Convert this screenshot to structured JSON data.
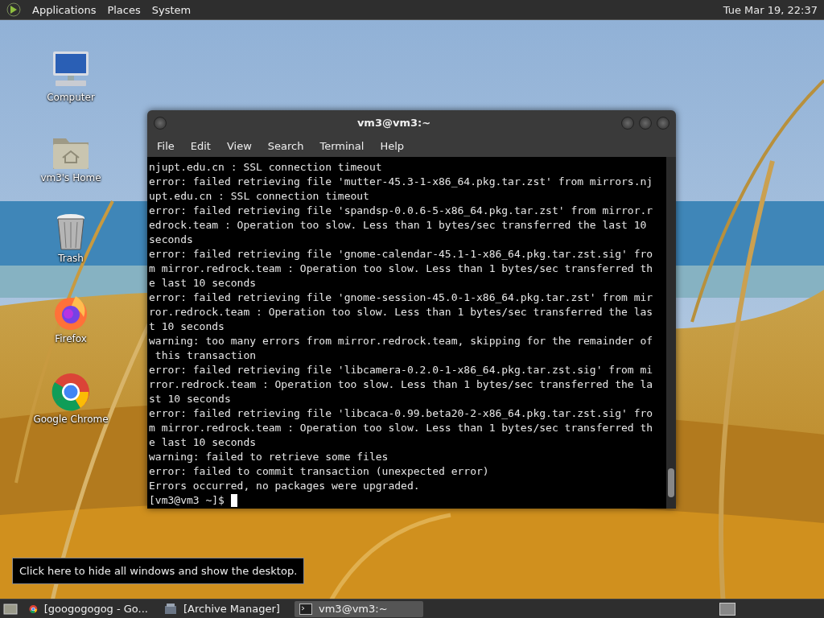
{
  "top_panel": {
    "menus": [
      "Applications",
      "Places",
      "System"
    ],
    "clock": "Tue Mar 19, 22:37"
  },
  "desktop_icons": [
    {
      "label": "Computer",
      "kind": "computer"
    },
    {
      "label": "vm3's Home",
      "kind": "home"
    },
    {
      "label": "Trash",
      "kind": "trash"
    },
    {
      "label": "Firefox",
      "kind": "firefox"
    },
    {
      "label": "Google Chrome",
      "kind": "chrome"
    }
  ],
  "terminal": {
    "title": "vm3@vm3:~",
    "menu": [
      "File",
      "Edit",
      "View",
      "Search",
      "Terminal",
      "Help"
    ],
    "lines": [
      "njupt.edu.cn : SSL connection timeout",
      "error: failed retrieving file 'mutter-45.3-1-x86_64.pkg.tar.zst' from mirrors.nj",
      "upt.edu.cn : SSL connection timeout",
      "error: failed retrieving file 'spandsp-0.0.6-5-x86_64.pkg.tar.zst' from mirror.r",
      "edrock.team : Operation too slow. Less than 1 bytes/sec transferred the last 10",
      "seconds",
      "error: failed retrieving file 'gnome-calendar-45.1-1-x86_64.pkg.tar.zst.sig' fro",
      "m mirror.redrock.team : Operation too slow. Less than 1 bytes/sec transferred th",
      "e last 10 seconds",
      "error: failed retrieving file 'gnome-session-45.0-1-x86_64.pkg.tar.zst' from mir",
      "ror.redrock.team : Operation too slow. Less than 1 bytes/sec transferred the las",
      "t 10 seconds",
      "warning: too many errors from mirror.redrock.team, skipping for the remainder of",
      " this transaction",
      "error: failed retrieving file 'libcamera-0.2.0-1-x86_64.pkg.tar.zst.sig' from mi",
      "rror.redrock.team : Operation too slow. Less than 1 bytes/sec transferred the la",
      "st 10 seconds",
      "error: failed retrieving file 'libcaca-0.99.beta20-2-x86_64.pkg.tar.zst.sig' fro",
      "m mirror.redrock.team : Operation too slow. Less than 1 bytes/sec transferred th",
      "e last 10 seconds",
      "warning: failed to retrieve some files",
      "error: failed to commit transaction (unexpected error)",
      "Errors occurred, no packages were upgraded."
    ],
    "prompt": "[vm3@vm3 ~]$"
  },
  "tooltip": {
    "text": "Click here to hide all windows and show the desktop."
  },
  "taskbar": {
    "tasks": [
      {
        "label": "[googogogog - Go...",
        "kind": "chrome",
        "selected": false
      },
      {
        "label": "[Archive Manager]",
        "kind": "archive",
        "selected": false
      },
      {
        "label": "vm3@vm3:~",
        "kind": "terminal",
        "selected": true
      }
    ]
  }
}
